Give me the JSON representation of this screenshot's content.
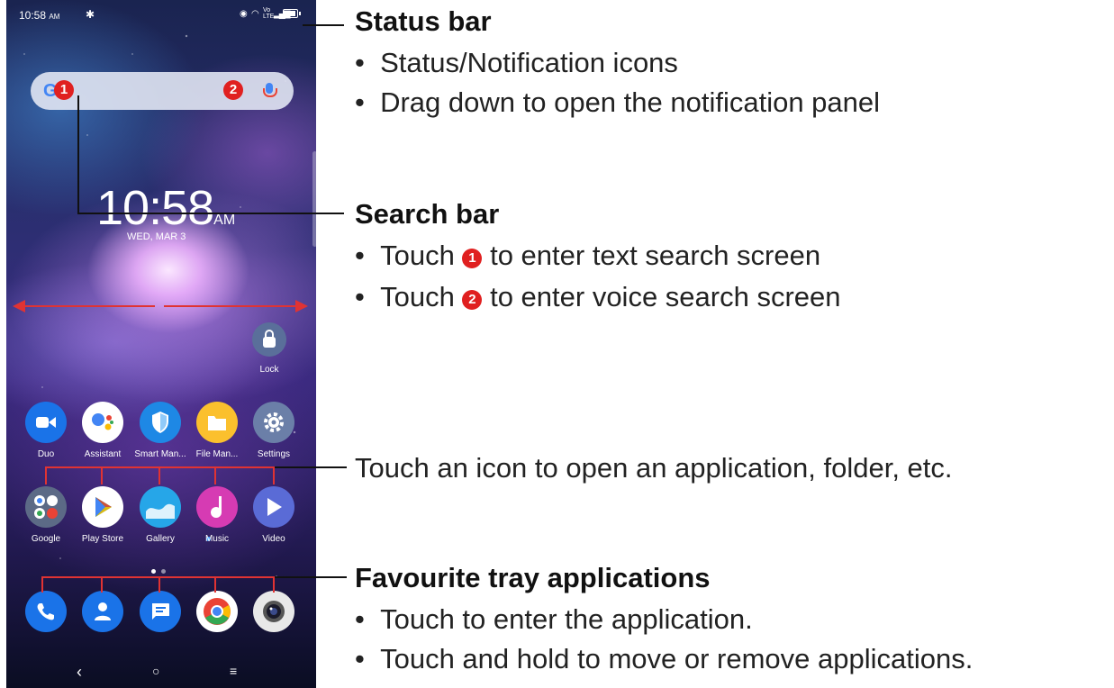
{
  "status_bar": {
    "time": "10:58",
    "ampm": "AM"
  },
  "search": {
    "g": "G",
    "badge1": "1",
    "badge2": "2"
  },
  "clock": {
    "time": "10:58",
    "ampm": "AM",
    "date": "WED, MAR 3"
  },
  "lock_label": "Lock",
  "row1": [
    "Duo",
    "Assistant",
    "Smart Man...",
    "File Man...",
    "Settings"
  ],
  "row2": [
    "Google",
    "Play Store",
    "Gallery",
    "Music",
    "Video"
  ],
  "annotations": {
    "status_bar": {
      "title": "Status bar",
      "bullets": [
        "Status/Notification icons",
        "Drag down to open the notification panel"
      ]
    },
    "search_bar": {
      "title": "Search bar",
      "bullet1": {
        "before": "Touch",
        "badge": "1",
        "after": "to enter text search screen"
      },
      "bullet2": {
        "before": "Touch",
        "badge": "2",
        "after": "to enter voice search screen"
      }
    },
    "icons_note": "Touch an icon to open an application, folder, etc.",
    "favourites": {
      "title": "Favourite tray applications",
      "bullets": [
        "Touch to enter the application.",
        "Touch and hold to move or remove applications."
      ]
    }
  },
  "bullet_char": "•",
  "colors": {
    "accent_red": "#e03333",
    "badge_red": "#e02020"
  }
}
